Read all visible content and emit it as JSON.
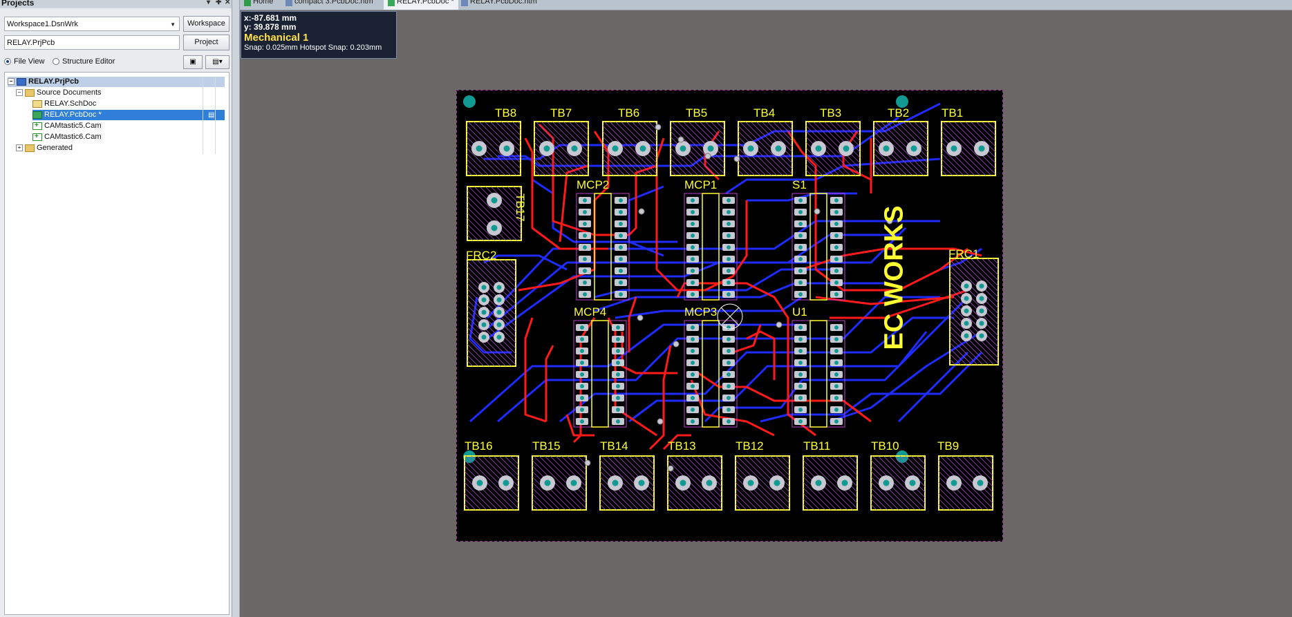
{
  "projects_panel": {
    "title": "Projects",
    "workspace_value": "Workspace1.DsnWrk",
    "workspace_button": "Workspace",
    "project_value": "RELAY.PrjPcb",
    "project_button": "Project",
    "view_file": "File View",
    "view_structure": "Structure Editor",
    "tree": {
      "root": "RELAY.PrjPcb",
      "source_folder": "Source Documents",
      "items": [
        "RELAY.SchDoc",
        "RELAY.PcbDoc *",
        "CAMtastic5.Cam",
        "CAMtastic6.Cam"
      ],
      "generated": "Generated"
    }
  },
  "tabs": [
    {
      "label": "Home",
      "active": false
    },
    {
      "label": "compact 3.PcbDoc.htm",
      "active": false
    },
    {
      "label": "RELAY.PcbDoc *",
      "active": true
    },
    {
      "label": "RELAY.PcbDoc.htm",
      "active": false
    }
  ],
  "hud": {
    "x": "x:-87.681 mm",
    "y": "y: 39.878  mm",
    "layer": "Mechanical 1",
    "snap": "Snap: 0.025mm Hotspot Snap: 0.203mm"
  },
  "pcb": {
    "top_terminals": [
      "TB8",
      "TB7",
      "TB6",
      "TB5",
      "TB4",
      "TB3",
      "TB2",
      "TB1"
    ],
    "bottom_terminals": [
      "TB16",
      "TB15",
      "TB14",
      "TB13",
      "TB12",
      "TB11",
      "TB10",
      "TB9"
    ],
    "tb17": "TB17",
    "frc_left": "FRC2",
    "frc_right": "FRC1",
    "ics": [
      "MCP2",
      "MCP1",
      "S1",
      "MCP4",
      "MCP3",
      "U1"
    ],
    "brand": "EC WORKS",
    "colors": {
      "silkscreen": "#ffff33",
      "top_layer": "#ff1a1a",
      "bottom_layer": "#1f2cff",
      "pad": "#c8c8d2",
      "hole": "#119a91"
    }
  }
}
